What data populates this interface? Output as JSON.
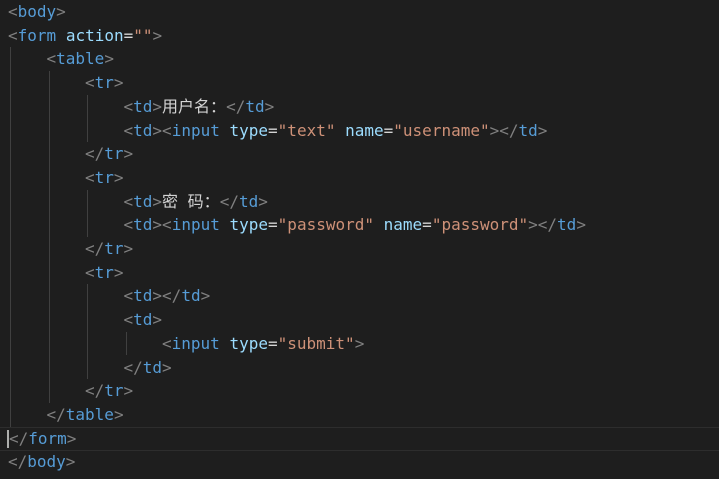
{
  "editor": {
    "language": "html",
    "lines": [
      {
        "indent": 0,
        "tokens": [
          [
            "bracket",
            "<"
          ],
          [
            "tag",
            "body"
          ],
          [
            "bracket",
            ">"
          ]
        ]
      },
      {
        "indent": 0,
        "tokens": [
          [
            "bracket",
            "<"
          ],
          [
            "tag",
            "form"
          ],
          [
            "txt",
            " "
          ],
          [
            "attr",
            "action"
          ],
          [
            "eq",
            "="
          ],
          [
            "str",
            "\"\""
          ],
          [
            "bracket",
            ">"
          ]
        ]
      },
      {
        "indent": 1,
        "tokens": [
          [
            "bracket",
            "<"
          ],
          [
            "tag",
            "table"
          ],
          [
            "bracket",
            ">"
          ]
        ]
      },
      {
        "indent": 2,
        "tokens": [
          [
            "bracket",
            "<"
          ],
          [
            "tag",
            "tr"
          ],
          [
            "bracket",
            ">"
          ]
        ]
      },
      {
        "indent": 3,
        "tokens": [
          [
            "bracket",
            "<"
          ],
          [
            "tag",
            "td"
          ],
          [
            "bracket",
            ">"
          ],
          [
            "txt",
            "用户名："
          ],
          [
            "bracket",
            "</"
          ],
          [
            "tag",
            "td"
          ],
          [
            "bracket",
            ">"
          ]
        ]
      },
      {
        "indent": 3,
        "tokens": [
          [
            "bracket",
            "<"
          ],
          [
            "tag",
            "td"
          ],
          [
            "bracket",
            ">"
          ],
          [
            "bracket",
            "<"
          ],
          [
            "tag",
            "input"
          ],
          [
            "txt",
            " "
          ],
          [
            "attr",
            "type"
          ],
          [
            "eq",
            "="
          ],
          [
            "str",
            "\"text\""
          ],
          [
            "txt",
            " "
          ],
          [
            "attr",
            "name"
          ],
          [
            "eq",
            "="
          ],
          [
            "str",
            "\"username\""
          ],
          [
            "bracket",
            ">"
          ],
          [
            "bracket",
            "</"
          ],
          [
            "tag",
            "td"
          ],
          [
            "bracket",
            ">"
          ]
        ]
      },
      {
        "indent": 2,
        "tokens": [
          [
            "bracket",
            "</"
          ],
          [
            "tag",
            "tr"
          ],
          [
            "bracket",
            ">"
          ]
        ]
      },
      {
        "indent": 2,
        "tokens": [
          [
            "bracket",
            "<"
          ],
          [
            "tag",
            "tr"
          ],
          [
            "bracket",
            ">"
          ]
        ]
      },
      {
        "indent": 3,
        "tokens": [
          [
            "bracket",
            "<"
          ],
          [
            "tag",
            "td"
          ],
          [
            "bracket",
            ">"
          ],
          [
            "txt",
            "密 码："
          ],
          [
            "bracket",
            "</"
          ],
          [
            "tag",
            "td"
          ],
          [
            "bracket",
            ">"
          ]
        ]
      },
      {
        "indent": 3,
        "tokens": [
          [
            "bracket",
            "<"
          ],
          [
            "tag",
            "td"
          ],
          [
            "bracket",
            ">"
          ],
          [
            "bracket",
            "<"
          ],
          [
            "tag",
            "input"
          ],
          [
            "txt",
            " "
          ],
          [
            "attr",
            "type"
          ],
          [
            "eq",
            "="
          ],
          [
            "str",
            "\"password\""
          ],
          [
            "txt",
            " "
          ],
          [
            "attr",
            "name"
          ],
          [
            "eq",
            "="
          ],
          [
            "str",
            "\"password\""
          ],
          [
            "bracket",
            ">"
          ],
          [
            "bracket",
            "</"
          ],
          [
            "tag",
            "td"
          ],
          [
            "bracket",
            ">"
          ]
        ]
      },
      {
        "indent": 2,
        "tokens": [
          [
            "bracket",
            "</"
          ],
          [
            "tag",
            "tr"
          ],
          [
            "bracket",
            ">"
          ]
        ]
      },
      {
        "indent": 2,
        "tokens": [
          [
            "bracket",
            "<"
          ],
          [
            "tag",
            "tr"
          ],
          [
            "bracket",
            ">"
          ]
        ]
      },
      {
        "indent": 3,
        "tokens": [
          [
            "bracket",
            "<"
          ],
          [
            "tag",
            "td"
          ],
          [
            "bracket",
            ">"
          ],
          [
            "bracket",
            "</"
          ],
          [
            "tag",
            "td"
          ],
          [
            "bracket",
            ">"
          ]
        ]
      },
      {
        "indent": 3,
        "tokens": [
          [
            "bracket",
            "<"
          ],
          [
            "tag",
            "td"
          ],
          [
            "bracket",
            ">"
          ]
        ]
      },
      {
        "indent": 4,
        "tokens": [
          [
            "bracket",
            "<"
          ],
          [
            "tag",
            "input"
          ],
          [
            "txt",
            " "
          ],
          [
            "attr",
            "type"
          ],
          [
            "eq",
            "="
          ],
          [
            "str",
            "\"submit\""
          ],
          [
            "bracket",
            ">"
          ]
        ]
      },
      {
        "indent": 3,
        "tokens": [
          [
            "bracket",
            "</"
          ],
          [
            "tag",
            "td"
          ],
          [
            "bracket",
            ">"
          ]
        ]
      },
      {
        "indent": 2,
        "tokens": [
          [
            "bracket",
            "</"
          ],
          [
            "tag",
            "tr"
          ],
          [
            "bracket",
            ">"
          ]
        ]
      },
      {
        "indent": 1,
        "tokens": [
          [
            "bracket",
            "</"
          ],
          [
            "tag",
            "table"
          ],
          [
            "bracket",
            ">"
          ]
        ]
      },
      {
        "indent": 0,
        "current": true,
        "tokens": [
          [
            "bracket",
            "</"
          ],
          [
            "tag",
            "form"
          ],
          [
            "bracket",
            ">"
          ]
        ]
      },
      {
        "indent": 0,
        "tokens": [
          [
            "bracket",
            "</"
          ],
          [
            "tag",
            "body"
          ],
          [
            "bracket",
            ">"
          ]
        ]
      }
    ]
  },
  "colors": {
    "background": "#1e1e1e",
    "bracket": "#808080",
    "tag": "#569cd6",
    "attribute": "#9cdcfe",
    "string": "#ce9178",
    "text": "#d4d4d4",
    "indent_guide": "#404040"
  }
}
